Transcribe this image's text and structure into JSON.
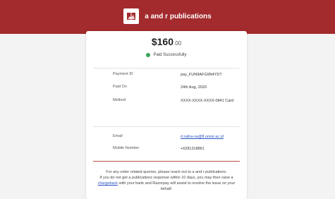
{
  "brand": {
    "name": "a and r publications",
    "logo_icon": "book-logo-icon"
  },
  "payment": {
    "amount_main": "$160",
    "amount_cents": ".00",
    "status": "Paid Successfully"
  },
  "details": [
    {
      "label": "Payment ID",
      "value": "pay_FUN9AFG9N4YDT"
    },
    {
      "label": "Paid On",
      "value": "24th Aug, 2020"
    },
    {
      "label": "Method",
      "value": "XXXX-XXXX-XXXX-0841 Card"
    }
  ],
  "contact": [
    {
      "label": "Email",
      "value": "rt.ratha-sa@fl.unisir.ac.id"
    },
    {
      "label": "Mobile Number",
      "value": "+6281318861"
    }
  ],
  "footer": {
    "line1": "For any order related queries, please reach out to a and r publications.",
    "line2_pre": "If you do not get a publications response within 10 days, you may then raise a",
    "chargeback_link": "chargeback",
    "line2_post": "with your bank and Razorpay will assist to resolve the issue on your behalf."
  },
  "colors": {
    "header": "#a32a2d",
    "status_green": "#3aa35b",
    "link": "#2a55c2"
  }
}
